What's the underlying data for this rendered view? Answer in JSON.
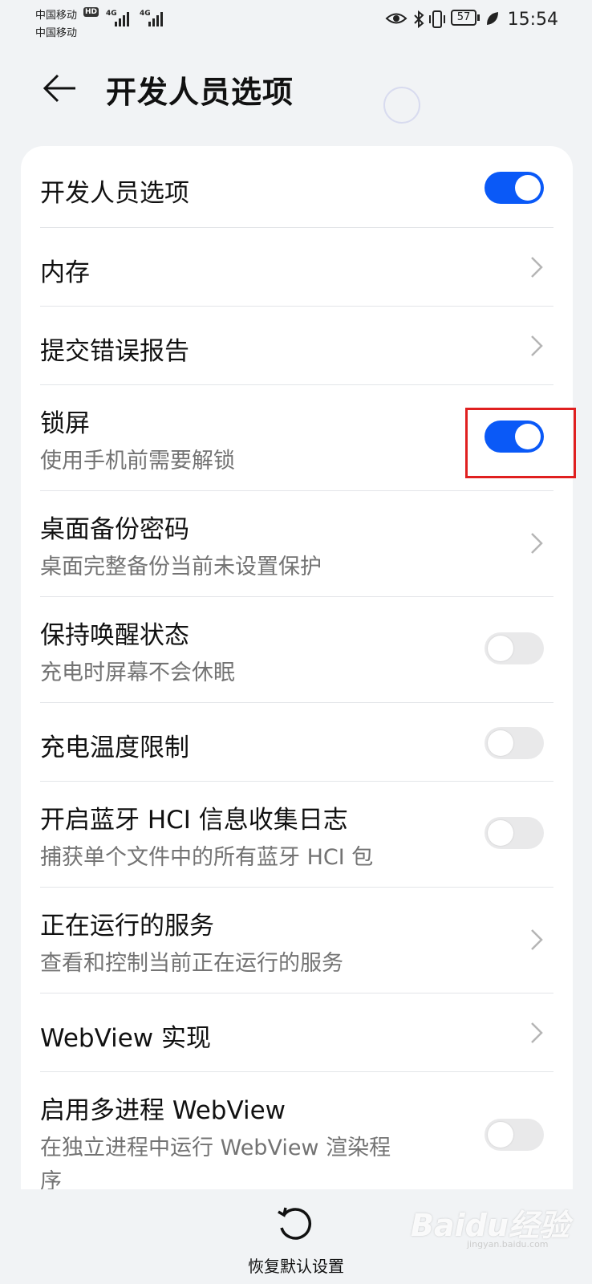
{
  "status_bar": {
    "carrier1": "中国移动",
    "carrier2": "中国移动",
    "hd_badge": "HD",
    "sig1_label": "4G",
    "sig2_label": "4G",
    "battery": "57",
    "time": "15:54",
    "icons": [
      "eye-icon",
      "bluetooth-icon",
      "vibrate-icon",
      "battery-icon",
      "leaf-icon"
    ]
  },
  "header": {
    "title": "开发人员选项"
  },
  "settings": [
    {
      "title": "开发人员选项",
      "subtitle": "",
      "control": "toggle",
      "state": "on"
    },
    {
      "title": "内存",
      "subtitle": "",
      "control": "chevron"
    },
    {
      "title": "提交错误报告",
      "subtitle": "",
      "control": "chevron"
    },
    {
      "title": "锁屏",
      "subtitle": "使用手机前需要解锁",
      "control": "toggle",
      "state": "on"
    },
    {
      "title": "桌面备份密码",
      "subtitle": "桌面完整备份当前未设置保护",
      "control": "chevron"
    },
    {
      "title": "保持唤醒状态",
      "subtitle": "充电时屏幕不会休眠",
      "control": "toggle",
      "state": "off"
    },
    {
      "title": "充电温度限制",
      "subtitle": "",
      "control": "toggle",
      "state": "off"
    },
    {
      "title": "开启蓝牙 HCI 信息收集日志",
      "subtitle": "捕获单个文件中的所有蓝牙 HCI 包",
      "control": "toggle",
      "state": "off"
    },
    {
      "title": "正在运行的服务",
      "subtitle": "查看和控制当前正在运行的服务",
      "control": "chevron"
    },
    {
      "title": "WebView 实现",
      "subtitle": "",
      "control": "chevron"
    },
    {
      "title": "启用多进程 WebView",
      "subtitle": "在独立进程中运行 WebView 渲染程",
      "subtitle2": "序",
      "control": "toggle",
      "state": "off"
    }
  ],
  "bottom": {
    "reset_label": "恢复默认设置"
  },
  "watermark": {
    "brand": "Baidu经验",
    "sub": "jingyan.baidu.com"
  },
  "colors": {
    "accent": "#0a59f7",
    "highlight": "#e02020",
    "background": "#f1f3f5"
  }
}
